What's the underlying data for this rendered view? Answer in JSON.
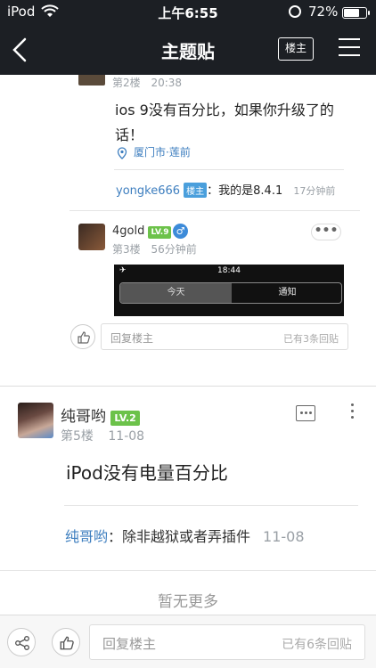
{
  "status_bar": {
    "carrier": "iPod",
    "time": "上午6:55",
    "battery_percent": "72%",
    "battery_level": 0.72
  },
  "nav": {
    "title": "主题贴",
    "louzhu_button": "楼主",
    "back_icon": "chevron-left-icon",
    "menu_icon": "hamburger-icon"
  },
  "post2": {
    "floor": "第2楼",
    "time": "20:38",
    "content": "ios 9没有百分比，如果你升级了的话！",
    "location": "厦门市·莲前",
    "reply": {
      "user": "yongke666",
      "badge": "楼主",
      "text": "：我的是8.4.1",
      "time": "17分钟前"
    }
  },
  "post3": {
    "username": "4gold",
    "level": "LV.9",
    "gender": "♂",
    "floor": "第3楼",
    "time": "56分钟前",
    "more": "•••",
    "screenshot": {
      "time": "18:44",
      "seg_left": "今天",
      "seg_right": "通知"
    },
    "reply_placeholder": "回复楼主",
    "reply_count": "已有3条回贴"
  },
  "post5": {
    "username": "纯哥哟",
    "level": "LV.2",
    "floor": "第5楼",
    "date": "11-08",
    "content": "iPod没有电量百分比",
    "reply": {
      "user": "纯哥哟",
      "text": "：除非越狱或者弄插件",
      "time": "11-08"
    }
  },
  "footer": {
    "no_more": "暂无更多"
  },
  "bottom_bar": {
    "reply_placeholder": "回复楼主",
    "reply_count": "已有6条回贴"
  },
  "colors": {
    "nav_bg": "#1c1f24",
    "link_blue": "#3d7ebf",
    "level_green": "#6cc24a",
    "louzhu_badge": "#4a9fdc"
  }
}
